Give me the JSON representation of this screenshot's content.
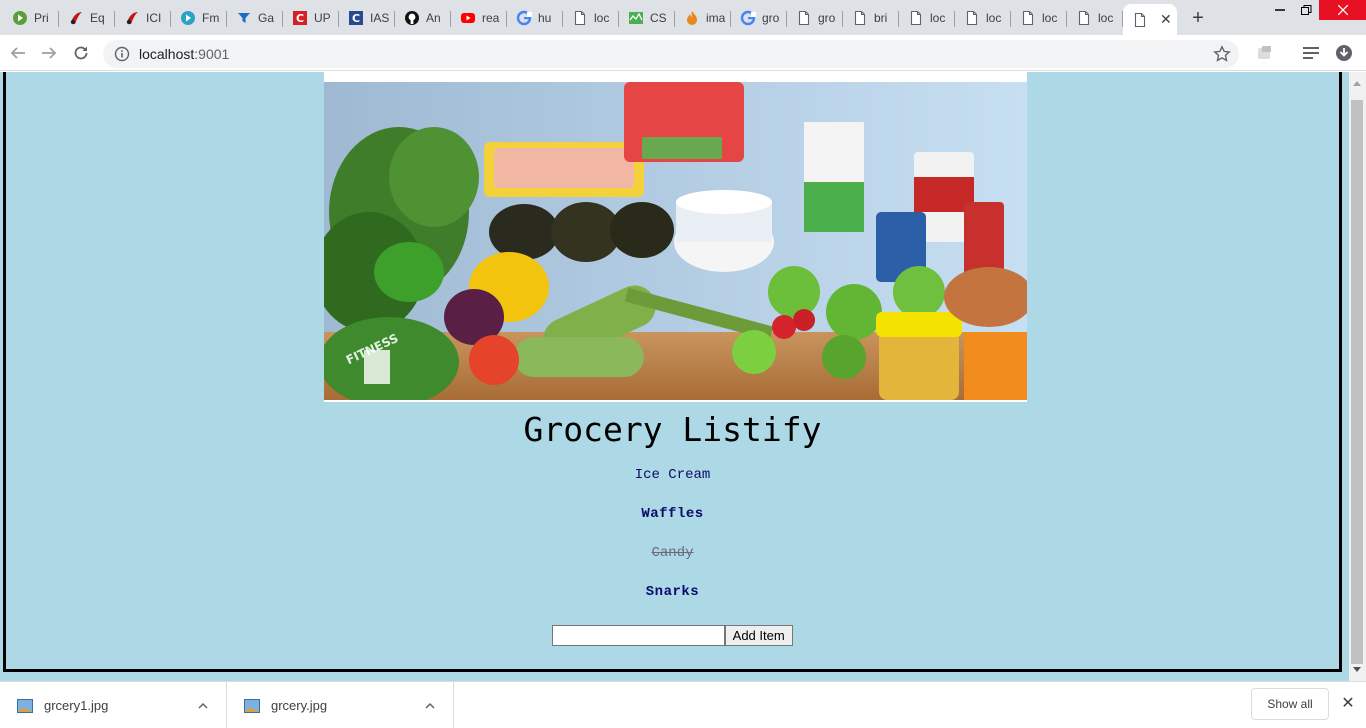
{
  "browser": {
    "tabs": [
      {
        "label": "Pri",
        "icon": "play-circle-green-icon",
        "color": "#5a9e3a"
      },
      {
        "label": "Eq",
        "icon": "red-swoosh-icon",
        "color": "#c0161f"
      },
      {
        "label": "ICI",
        "icon": "red-swoosh-icon",
        "color": "#c0161f"
      },
      {
        "label": "Fm",
        "icon": "play-circle-teal-icon",
        "color": "#2ba3c7"
      },
      {
        "label": "Ga",
        "icon": "funnel-blue-icon",
        "color": "#1a6fc2"
      },
      {
        "label": "UP",
        "icon": "letter-c-red-icon",
        "color": "#d61f26"
      },
      {
        "label": "IAS",
        "icon": "letter-c-blue-icon",
        "color": "#2a4a8f"
      },
      {
        "label": "An",
        "icon": "github-icon",
        "color": "#111111"
      },
      {
        "label": "rea",
        "icon": "youtube-icon",
        "color": "#ff0000"
      },
      {
        "label": "hu",
        "icon": "google-icon",
        "color": "#4285f4"
      },
      {
        "label": "loc",
        "icon": "page-icon",
        "color": "#5f6368"
      },
      {
        "label": "CS",
        "icon": "cs-green-icon",
        "color": "#4caf50"
      },
      {
        "label": "ima",
        "icon": "flame-icon",
        "color": "#e8891d"
      },
      {
        "label": "gro",
        "icon": "google-icon",
        "color": "#4285f4"
      },
      {
        "label": "gro",
        "icon": "page-icon",
        "color": "#5f6368"
      },
      {
        "label": "bri",
        "icon": "page-icon",
        "color": "#5f6368"
      },
      {
        "label": "loc",
        "icon": "page-icon",
        "color": "#5f6368"
      },
      {
        "label": "loc",
        "icon": "page-icon",
        "color": "#5f6368"
      },
      {
        "label": "loc",
        "icon": "page-icon",
        "color": "#5f6368"
      },
      {
        "label": "loc",
        "icon": "page-icon",
        "color": "#5f6368"
      }
    ],
    "url_host": "localhost",
    "url_port": ":9001"
  },
  "page": {
    "title": "Grocery Listify",
    "items": [
      {
        "text": "Ice Cream",
        "style": "normal"
      },
      {
        "text": "Waffles",
        "style": "bold"
      },
      {
        "text": "Candy",
        "style": "done"
      },
      {
        "text": "Snarks",
        "style": "bold"
      }
    ],
    "input_value": "",
    "add_button": "Add Item",
    "hero_watermark": "FITNESS",
    "background_color": "#add8e6"
  },
  "downloads": {
    "files": [
      "grcery1.jpg",
      "grcery.jpg"
    ],
    "show_all": "Show all"
  }
}
